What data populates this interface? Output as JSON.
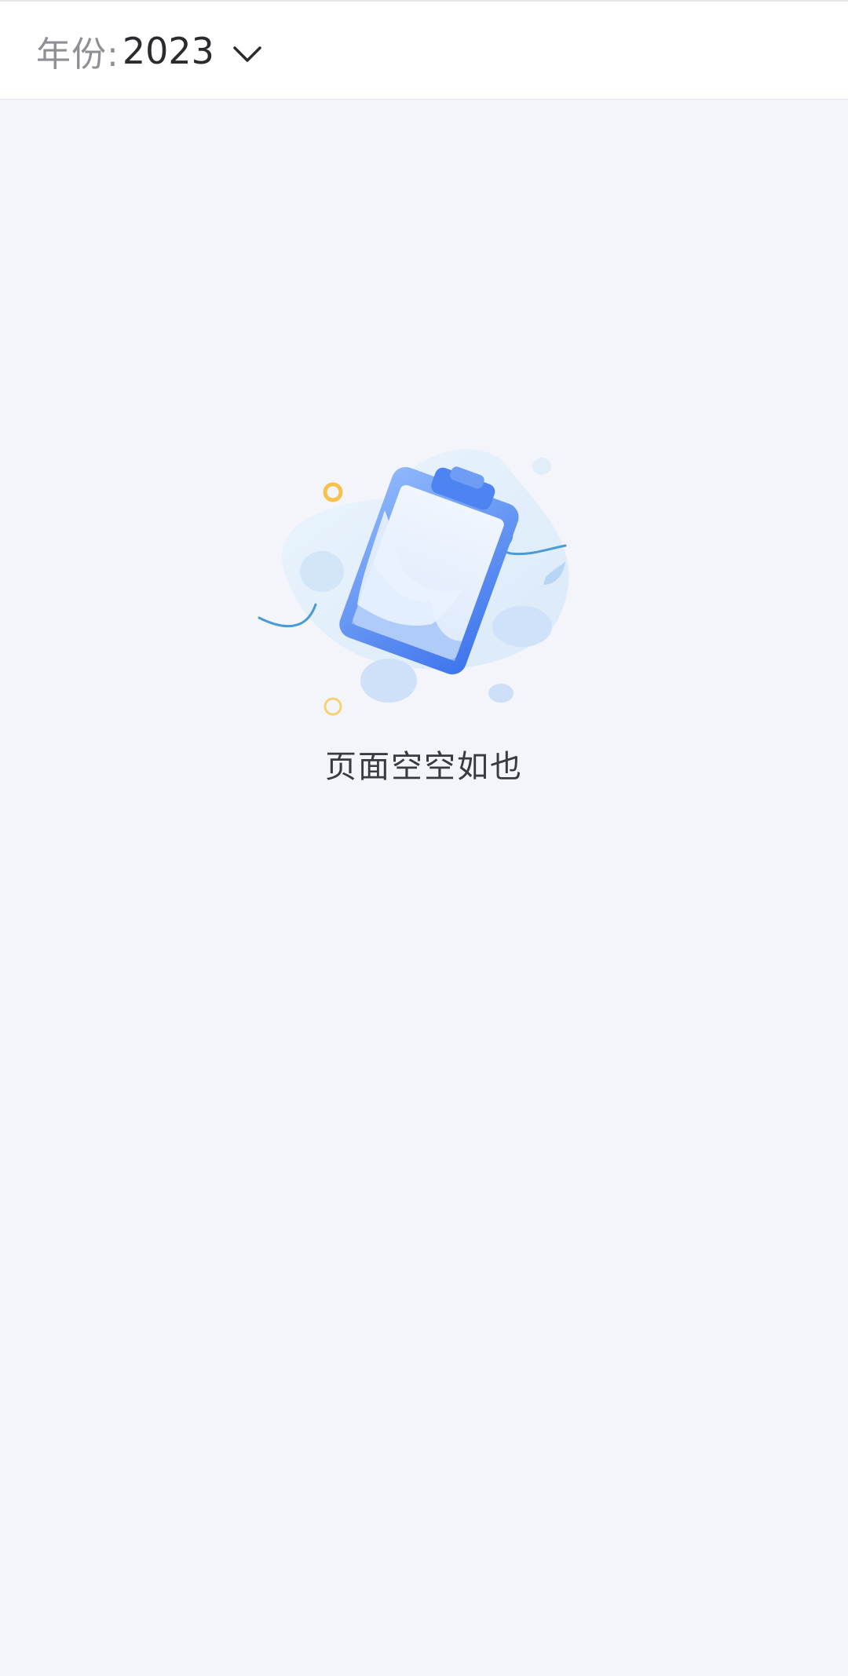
{
  "filter": {
    "year_label": "年份:",
    "year_value": "2023",
    "dropdown_icon": "chevron-down-icon"
  },
  "empty_state": {
    "illustration": "empty-clipboard-illustration",
    "message": "页面空空如也"
  },
  "colors": {
    "background": "#f4f5fa",
    "bar_background": "#ffffff",
    "accent_blue": "#4d84f2",
    "dot_yellow": "#f6c24e"
  }
}
